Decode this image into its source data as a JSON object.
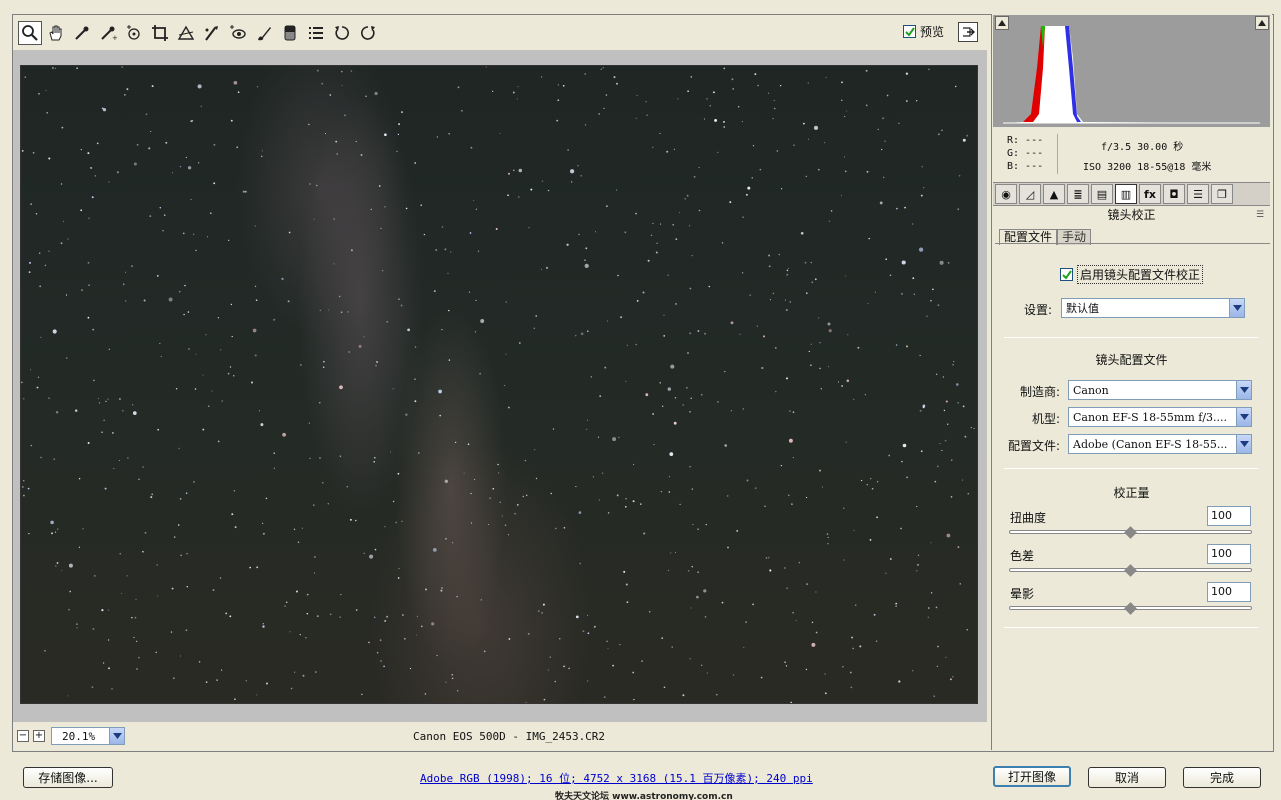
{
  "toolbar": {
    "tools": [
      "zoom-tool",
      "hand-tool",
      "white-balance-tool",
      "color-sampler-tool",
      "target-adjustment-tool",
      "crop-tool",
      "straighten-tool",
      "spot-removal-tool",
      "red-eye-tool",
      "adjustment-brush-tool",
      "graduated-filter-tool",
      "preferences-tool",
      "rotate-ccw-tool",
      "rotate-cw-tool"
    ],
    "preview_label": "预览"
  },
  "status": {
    "zoom_value": "20.1%",
    "filename": "Canon EOS 500D -  IMG_2453.CR2"
  },
  "info": {
    "r": "R:  ---",
    "g": "G:  ---",
    "b": "B:  ---",
    "exif_line1": "f/3.5  30.00 秒",
    "exif_line2": "ISO 3200  18-55@18 毫米"
  },
  "panel": {
    "title": "镜头校正",
    "subtab_profile": "配置文件",
    "subtab_manual": "手动",
    "enable_label": "启用镜头配置文件校正",
    "setup_label": "设置:",
    "setup_value": "默认值",
    "profile_section": "镜头配置文件",
    "make_label": "制造商:",
    "make_value": "Canon",
    "model_label": "机型:",
    "model_value": "Canon EF-S 18-55mm f/3....",
    "profile_label": "配置文件:",
    "profile_value": "Adobe (Canon EF-S 18-55...",
    "amount_section": "校正量",
    "sliders": [
      {
        "label": "扭曲度",
        "value": "100"
      },
      {
        "label": "色差",
        "value": "100"
      },
      {
        "label": "晕影",
        "value": "100"
      }
    ]
  },
  "bottom": {
    "save_label": "存储图像...",
    "workflow_text": "Adobe RGB (1998); 16 位; 4752 x 3168 (15.1 百万像素); 240 ppi",
    "open_label": "打开图像",
    "cancel_label": "取消",
    "done_label": "完成",
    "watermark": "牧夫天文论坛 www.astronomy.com.cn"
  },
  "colors": {
    "accent": "#3c7fb1",
    "link": "#0000cc"
  }
}
